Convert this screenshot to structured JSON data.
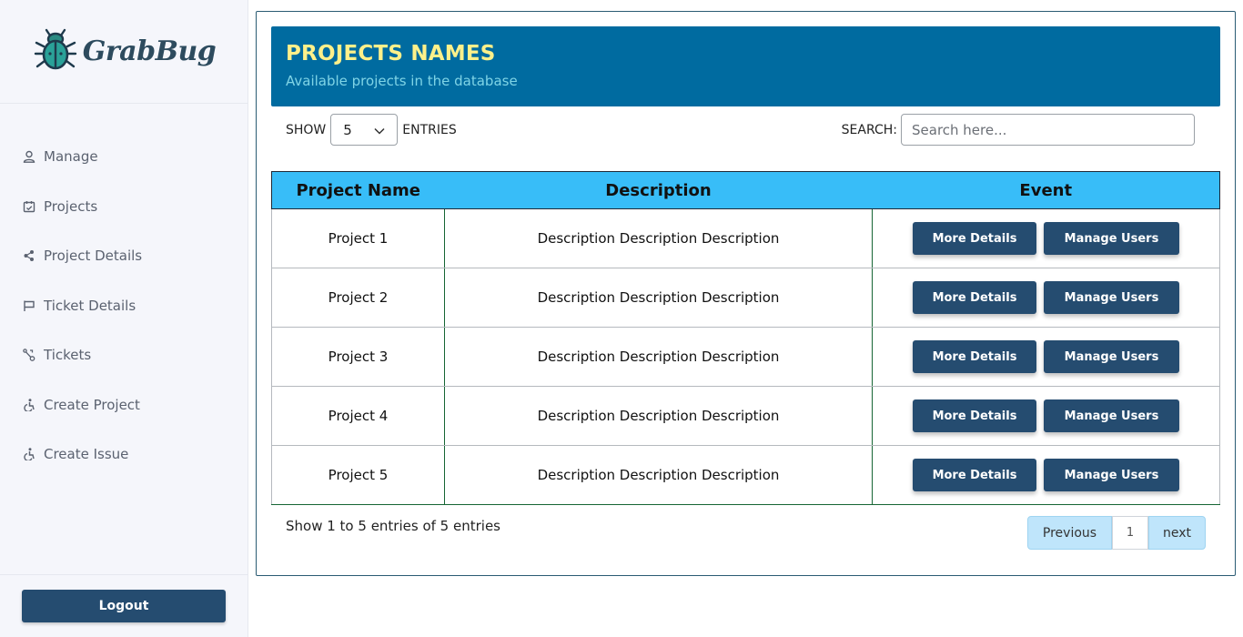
{
  "app": {
    "logo_text": "GrabBug"
  },
  "sidebar": {
    "items": [
      {
        "label": "Manage",
        "icon": "user-icon"
      },
      {
        "label": "Projects",
        "icon": "calendar-check-icon"
      },
      {
        "label": "Project Details",
        "icon": "share-nodes-icon"
      },
      {
        "label": "Ticket Details",
        "icon": "flag-icon"
      },
      {
        "label": "Tickets",
        "icon": "branch-icon"
      },
      {
        "label": "Create Project",
        "icon": "accessible-icon"
      },
      {
        "label": "Create Issue",
        "icon": "accessible-icon"
      }
    ],
    "logout_label": "Logout"
  },
  "banner": {
    "title": "PROJECTS NAMES",
    "subtitle": "Available projects in the database"
  },
  "controls": {
    "show_label": "SHOW",
    "entries_value": "5",
    "entries_label": "ENTRIES",
    "search_label": "SEARCH:",
    "search_placeholder": "Search here..."
  },
  "table": {
    "headers": [
      "Project Name",
      "Description",
      "Event"
    ],
    "rows": [
      {
        "name": "Project 1",
        "description": "Description Description Description"
      },
      {
        "name": "Project 2",
        "description": "Description Description Description"
      },
      {
        "name": "Project 3",
        "description": "Description Description Description"
      },
      {
        "name": "Project 4",
        "description": "Description Description Description"
      },
      {
        "name": "Project 5",
        "description": "Description Description Description"
      }
    ],
    "more_label": "More Details",
    "manage_label": "Manage Users"
  },
  "footer": {
    "info": "Show 1 to 5 entries of 5 entries",
    "prev_label": "Previous",
    "page": "1",
    "next_label": "next"
  },
  "colors": {
    "primary": "#254c70",
    "banner": "#006ba0",
    "banner_title": "#fef08a",
    "table_header": "#38bdf8"
  }
}
